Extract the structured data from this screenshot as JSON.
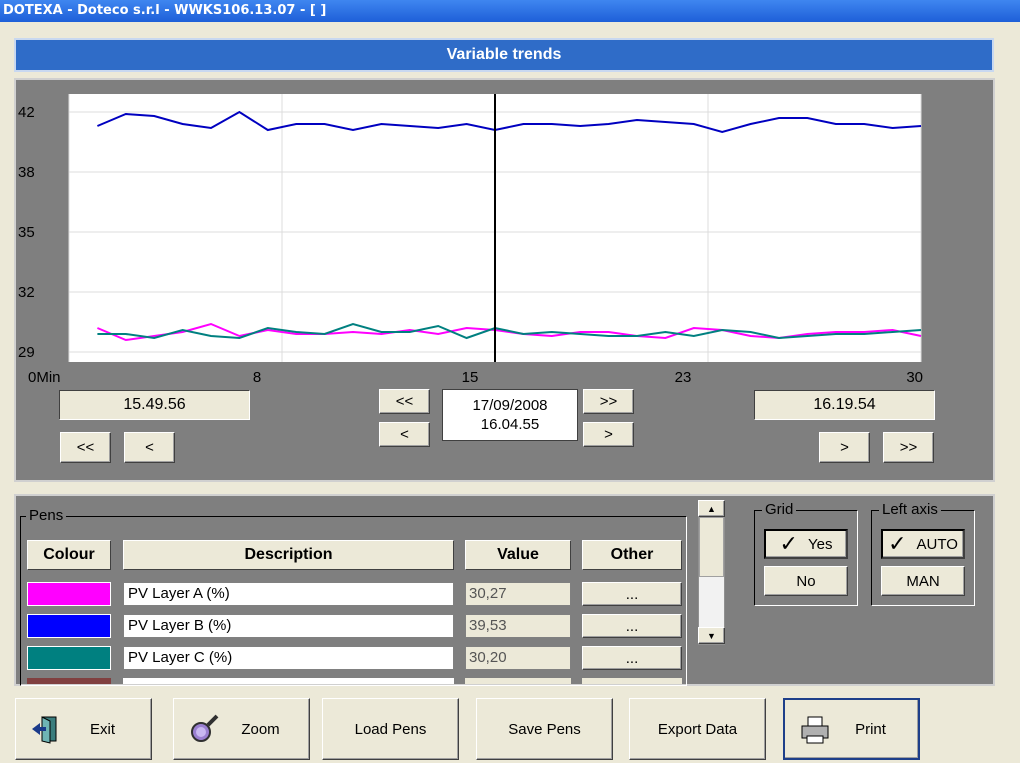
{
  "window": {
    "title": "DOTEXA - Doteco s.r.l - WWKS106.13.07 - [ ]"
  },
  "header": {
    "title": "Variable trends"
  },
  "chart_data": {
    "type": "line",
    "title": "",
    "xlabel": "",
    "ylabel": "",
    "x_ticks": [
      "0Min",
      "8",
      "15",
      "23",
      "30"
    ],
    "x_tick_values": [
      0,
      7.5,
      15,
      22.5,
      30
    ],
    "y_ticks": [
      "42",
      "38",
      "35",
      "32",
      "29"
    ],
    "y_tick_values": [
      40.5,
      37.5,
      34.5,
      31.5,
      28.5
    ],
    "xlim": [
      0,
      30
    ],
    "ylim": [
      28,
      41.4
    ],
    "grid": true,
    "cursor_x": 15,
    "x": [
      1,
      2,
      3,
      4,
      5,
      6,
      7,
      8,
      9,
      10,
      11,
      12,
      13,
      14,
      15,
      16,
      17,
      18,
      19,
      20,
      21,
      22,
      23,
      24,
      25,
      26,
      27,
      28,
      29,
      30
    ],
    "series": [
      {
        "color": "#0000c0",
        "values": [
          39.8,
          40.4,
          40.3,
          39.9,
          39.7,
          40.5,
          39.6,
          39.9,
          39.9,
          39.6,
          39.9,
          39.8,
          39.7,
          39.9,
          39.6,
          39.9,
          39.9,
          39.8,
          39.9,
          40.1,
          40.0,
          39.9,
          39.5,
          39.9,
          40.2,
          40.2,
          39.9,
          39.9,
          39.7,
          39.8
        ]
      },
      {
        "color": "#ff00ff",
        "values": [
          29.7,
          29.1,
          29.3,
          29.5,
          29.9,
          29.3,
          29.6,
          29.4,
          29.4,
          29.5,
          29.4,
          29.6,
          29.4,
          29.7,
          29.6,
          29.4,
          29.3,
          29.5,
          29.5,
          29.3,
          29.2,
          29.7,
          29.6,
          29.3,
          29.2,
          29.4,
          29.5,
          29.5,
          29.6,
          29.3
        ]
      },
      {
        "color": "#008080",
        "values": [
          29.4,
          29.4,
          29.2,
          29.6,
          29.3,
          29.2,
          29.7,
          29.5,
          29.4,
          29.9,
          29.5,
          29.5,
          29.8,
          29.2,
          29.7,
          29.4,
          29.5,
          29.4,
          29.3,
          29.3,
          29.5,
          29.3,
          29.6,
          29.5,
          29.2,
          29.3,
          29.4,
          29.4,
          29.5,
          29.6
        ]
      }
    ]
  },
  "nav": {
    "start_time": "15.49.56",
    "end_time": "16.19.54",
    "cursor_date": "17/09/2008",
    "cursor_time": "16.04.55",
    "first": "<<",
    "prev": "<",
    "next": ">",
    "last": ">>"
  },
  "pens": {
    "legend": "Pens",
    "columns": {
      "colour": "Colour",
      "description": "Description",
      "value": "Value",
      "other": "Other"
    },
    "other_label": "...",
    "rows": [
      {
        "color": "#ff00ff",
        "description": "PV Layer A (%)",
        "value": "30,27"
      },
      {
        "color": "#0000ff",
        "description": "PV Layer B (%)",
        "value": "39,53"
      },
      {
        "color": "#008080",
        "description": "PV Layer C (%)",
        "value": "30,20"
      }
    ]
  },
  "grid_group": {
    "legend": "Grid",
    "yes": "Yes",
    "no": "No",
    "check": "✓"
  },
  "axis_group": {
    "legend": "Left axis",
    "auto": "AUTO",
    "man": "MAN",
    "check": "✓"
  },
  "scroll": {
    "up": "▲",
    "down": "▼"
  },
  "toolbar": {
    "exit": "Exit",
    "zoom": "Zoom",
    "load_pens": "Load Pens",
    "save_pens": "Save Pens",
    "export_data": "Export Data",
    "print": "Print"
  }
}
